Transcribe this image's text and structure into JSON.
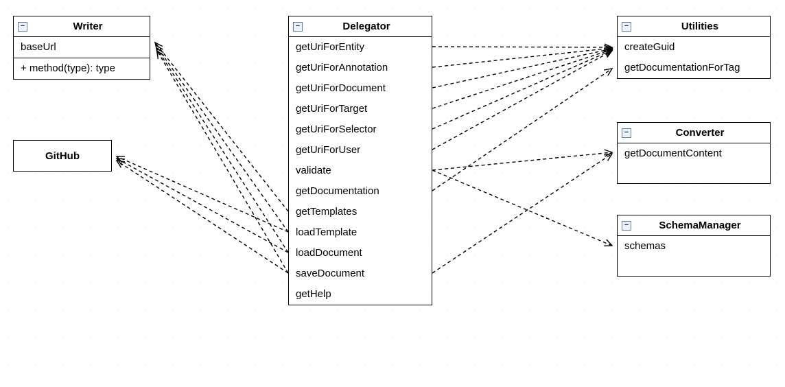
{
  "collapse_glyph": "−",
  "classes": {
    "writer": {
      "title": "Writer",
      "attrs": [
        "baseUrl"
      ],
      "ops": [
        "+ method(type): type"
      ]
    },
    "github": {
      "title": "GitHub"
    },
    "delegator": {
      "title": "Delegator",
      "members": [
        "getUriForEntity",
        "getUriForAnnotation",
        "getUriForDocument",
        "getUriForTarget",
        "getUriForSelector",
        "getUriForUser",
        "validate",
        "getDocumentation",
        "getTemplates",
        "loadTemplate",
        "loadDocument",
        "saveDocument",
        "getHelp"
      ]
    },
    "utilities": {
      "title": "Utilities",
      "members": [
        "createGuid",
        "getDocumentationForTag"
      ]
    },
    "converter": {
      "title": "Converter",
      "members": [
        "getDocumentContent"
      ]
    },
    "schemaManager": {
      "title": "SchemaManager",
      "members": [
        "schemas"
      ]
    }
  },
  "chart_data": {
    "type": "diagram",
    "nodes": [
      {
        "id": "Writer",
        "attributes": [
          "baseUrl"
        ],
        "operations": [
          "+ method(type): type"
        ]
      },
      {
        "id": "GitHub"
      },
      {
        "id": "Delegator",
        "members": [
          "getUriForEntity",
          "getUriForAnnotation",
          "getUriForDocument",
          "getUriForTarget",
          "getUriForSelector",
          "getUriForUser",
          "validate",
          "getDocumentation",
          "getTemplates",
          "loadTemplate",
          "loadDocument",
          "saveDocument",
          "getHelp"
        ]
      },
      {
        "id": "Utilities",
        "members": [
          "createGuid",
          "getDocumentationForTag"
        ]
      },
      {
        "id": "Converter",
        "members": [
          "getDocumentContent"
        ]
      },
      {
        "id": "SchemaManager",
        "members": [
          "schemas"
        ]
      }
    ],
    "edges": [
      {
        "from": "Delegator.getUriForEntity",
        "to": "Utilities.createGuid",
        "style": "dashed-open-arrow"
      },
      {
        "from": "Delegator.getUriForAnnotation",
        "to": "Utilities.createGuid",
        "style": "dashed-open-arrow"
      },
      {
        "from": "Delegator.getUriForDocument",
        "to": "Utilities.createGuid",
        "style": "dashed-open-arrow"
      },
      {
        "from": "Delegator.getUriForTarget",
        "to": "Utilities.createGuid",
        "style": "dashed-open-arrow"
      },
      {
        "from": "Delegator.getUriForSelector",
        "to": "Utilities.createGuid",
        "style": "dashed-open-arrow"
      },
      {
        "from": "Delegator.getUriForUser",
        "to": "Utilities.createGuid",
        "style": "dashed-open-arrow"
      },
      {
        "from": "Delegator.validate",
        "to": "Converter.getDocumentContent",
        "style": "dashed-open-arrow"
      },
      {
        "from": "Delegator.validate",
        "to": "SchemaManager.schemas",
        "style": "dashed-open-arrow"
      },
      {
        "from": "Delegator.getDocumentation",
        "to": "Utilities.getDocumentationForTag",
        "style": "dashed-open-arrow"
      },
      {
        "from": "Delegator.getTemplates",
        "to": "Writer",
        "style": "dashed-open-arrow"
      },
      {
        "from": "Delegator.loadTemplate",
        "to": "Writer",
        "style": "dashed-open-arrow"
      },
      {
        "from": "Delegator.loadTemplate",
        "to": "GitHub",
        "style": "dashed-open-arrow"
      },
      {
        "from": "Delegator.loadDocument",
        "to": "Writer",
        "style": "dashed-open-arrow"
      },
      {
        "from": "Delegator.loadDocument",
        "to": "GitHub",
        "style": "dashed-open-arrow"
      },
      {
        "from": "Delegator.saveDocument",
        "to": "Writer",
        "style": "dashed-open-arrow"
      },
      {
        "from": "Delegator.saveDocument",
        "to": "GitHub",
        "style": "dashed-open-arrow"
      },
      {
        "from": "Delegator.saveDocument",
        "to": "Converter.getDocumentContent",
        "style": "dashed-open-arrow"
      }
    ]
  }
}
